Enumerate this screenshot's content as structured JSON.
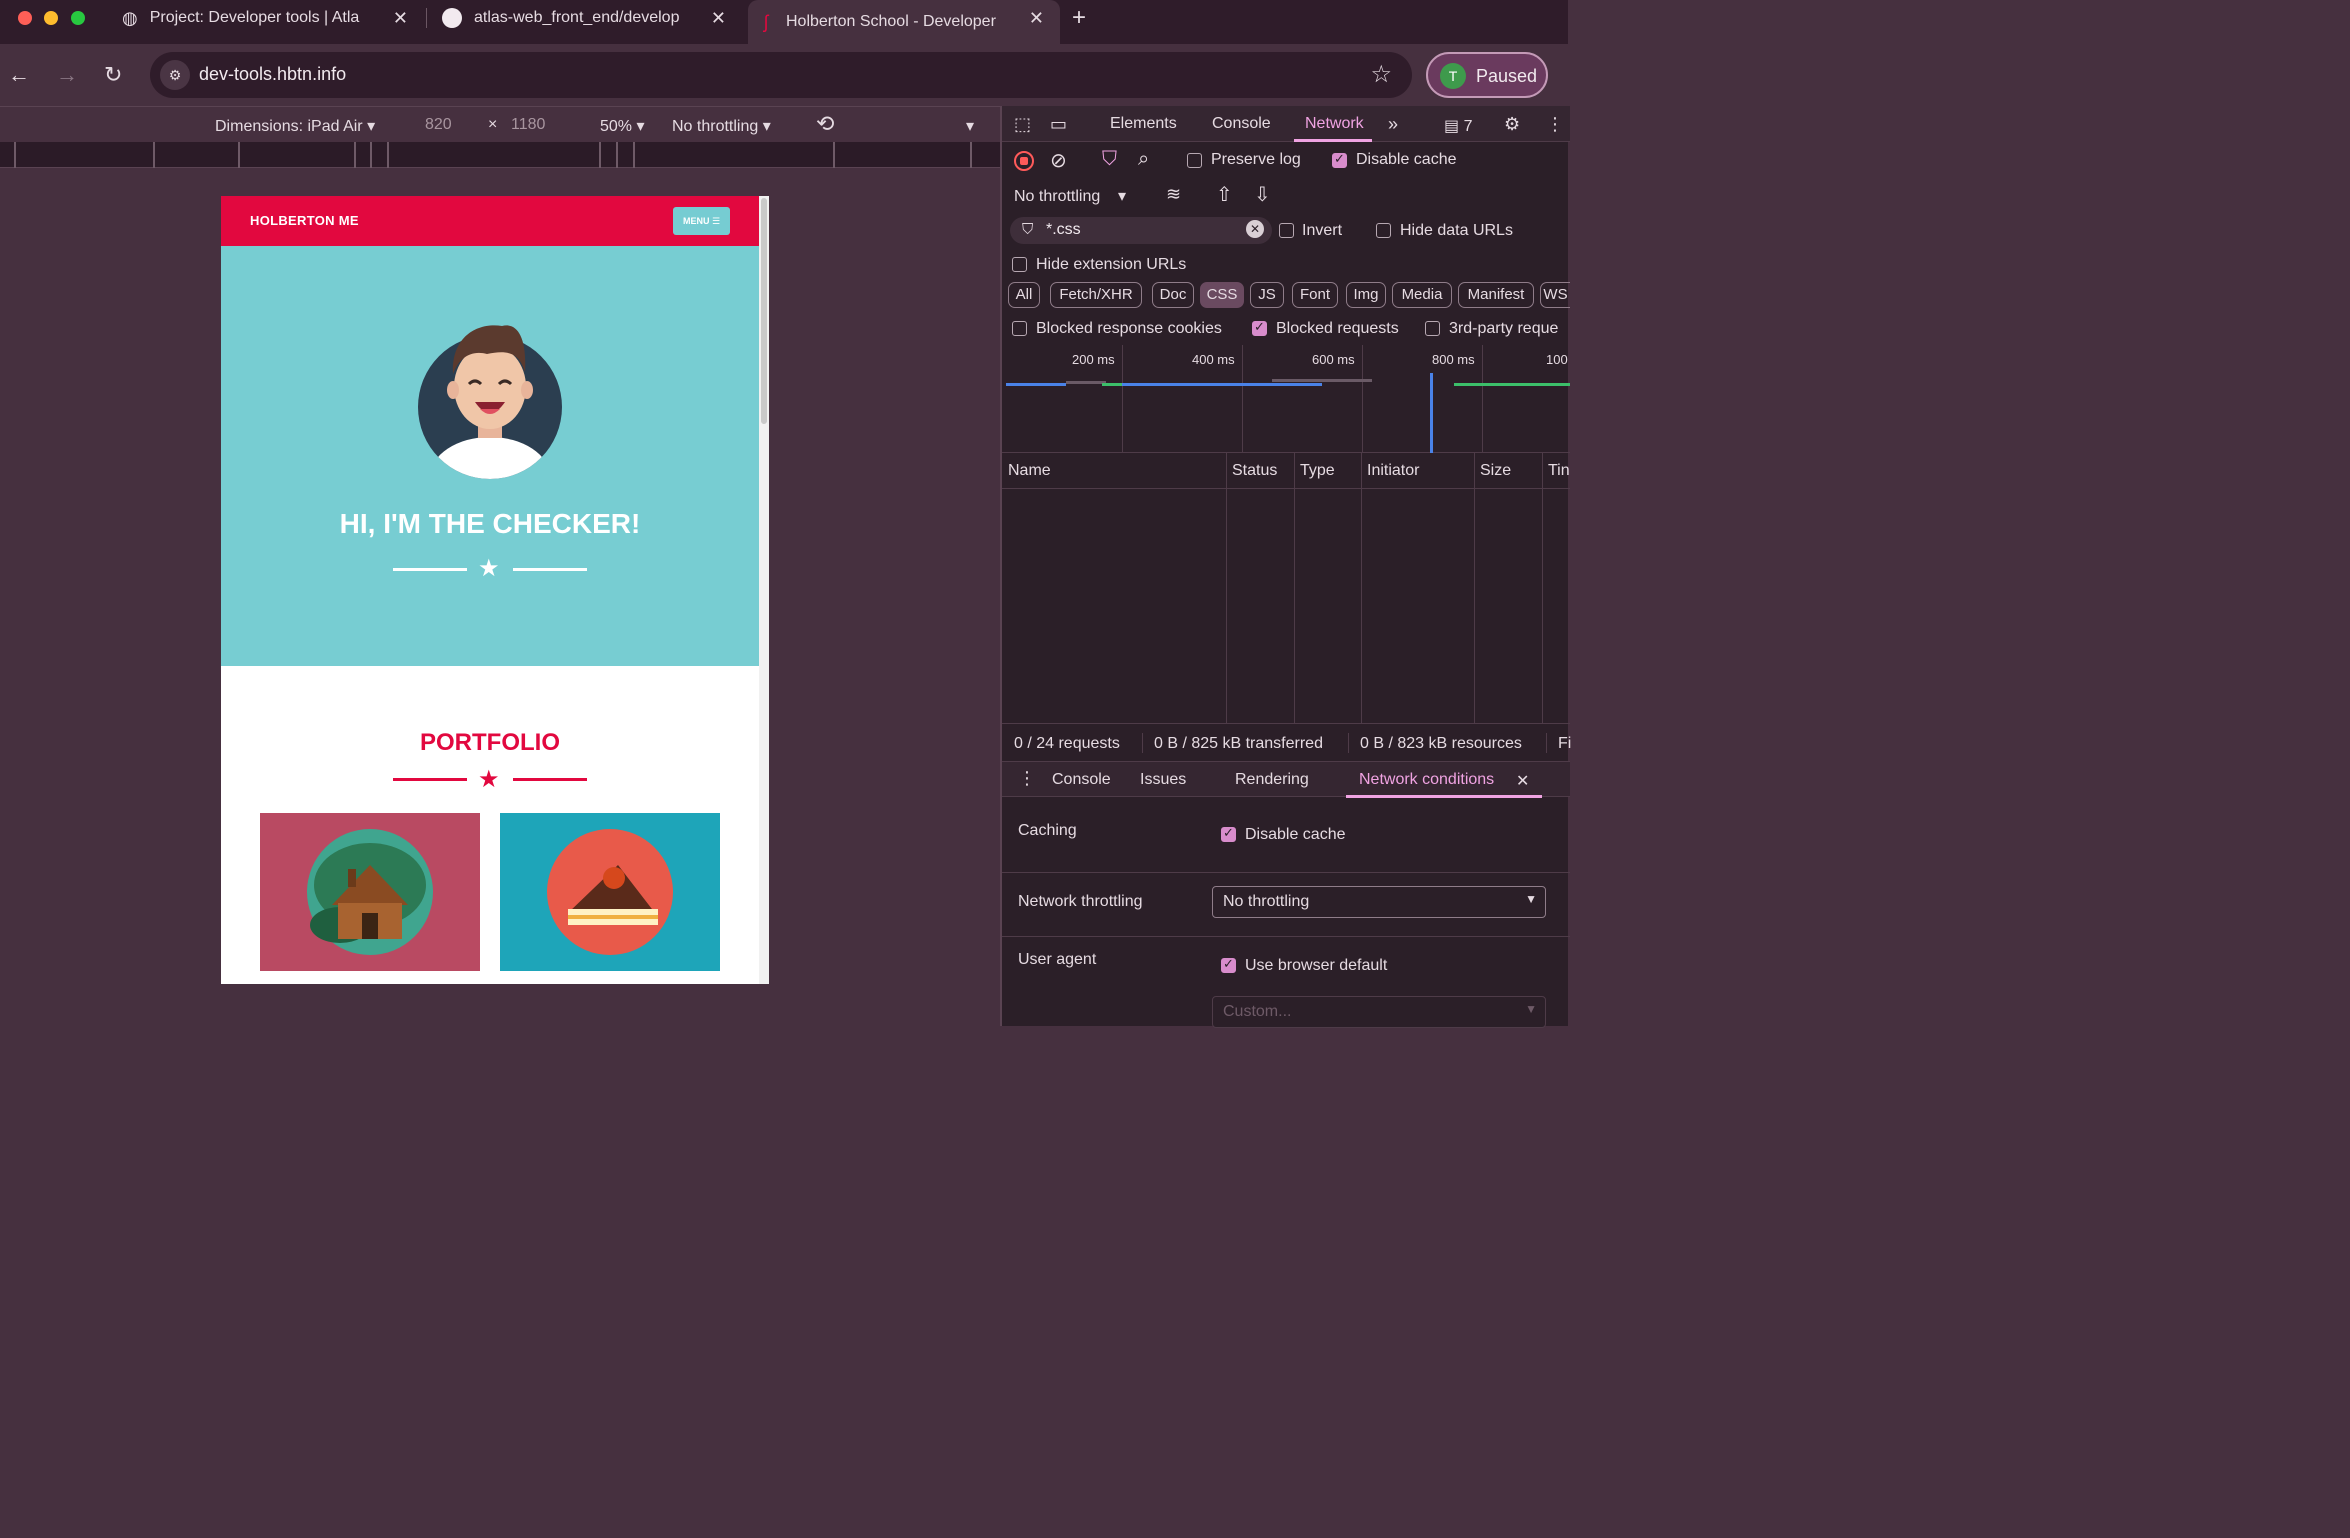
{
  "browser": {
    "tabs": [
      {
        "title": "Project: Developer tools | Atla"
      },
      {
        "title": "atlas-web_front_end/develop"
      },
      {
        "title": "Holberton School - Developer"
      }
    ],
    "new_tab": "+",
    "close_glyph": "✕",
    "address": "dev-tools.hbtn.info",
    "profile_initial": "T",
    "profile_label": "Paused"
  },
  "device_toolbar": {
    "dimensions_label": "Dimensions: iPad Air",
    "width": "820",
    "times": "×",
    "height": "1180",
    "zoom": "50%",
    "throttling": "No throttling"
  },
  "page": {
    "site_title": "HOLBERTON ME",
    "menu_label": "MENU ☰",
    "hero_title": "HI, I'M THE CHECKER!",
    "portfolio_title": "PORTFOLIO",
    "colors": {
      "brand": "#e2083f",
      "teal": "#77cdd2",
      "tile1": "#b94a62",
      "tile2": "#1ea5b9"
    }
  },
  "devtools": {
    "tabs": [
      "Elements",
      "Console",
      "Network"
    ],
    "active_tab": "Network",
    "messages_count": "7",
    "preserve_log": "Preserve log",
    "disable_cache": "Disable cache",
    "throttling": "No throttling",
    "filter_value": "*.css",
    "invert": "Invert",
    "hide_data_urls": "Hide data URLs",
    "hide_extension_urls": "Hide extension URLs",
    "type_chips": [
      "All",
      "Fetch/XHR",
      "Doc",
      "CSS",
      "JS",
      "Font",
      "Img",
      "Media",
      "Manifest",
      "WS"
    ],
    "active_chip": "CSS",
    "blocked_response_cookies": "Blocked response cookies",
    "blocked_requests": "Blocked requests",
    "third_party": "3rd-party reque",
    "timeline_labels": [
      "200 ms",
      "400 ms",
      "600 ms",
      "800 ms",
      "100"
    ],
    "columns": [
      "Name",
      "Status",
      "Type",
      "Initiator",
      "Size",
      "Tin"
    ],
    "status": {
      "requests": "0 / 24 requests",
      "transferred": "0 B / 825 kB transferred",
      "resources": "0 B / 823 kB resources",
      "extra": "Fi"
    },
    "drawer_tabs": [
      "Console",
      "Issues",
      "Rendering",
      "Network conditions"
    ],
    "network_conditions": {
      "caching_label": "Caching",
      "caching_cb": "Disable cache",
      "throttling_label": "Network throttling",
      "throttling_value": "No throttling",
      "ua_label": "User agent",
      "ua_cb": "Use browser default",
      "custom_placeholder": "Custom..."
    }
  }
}
